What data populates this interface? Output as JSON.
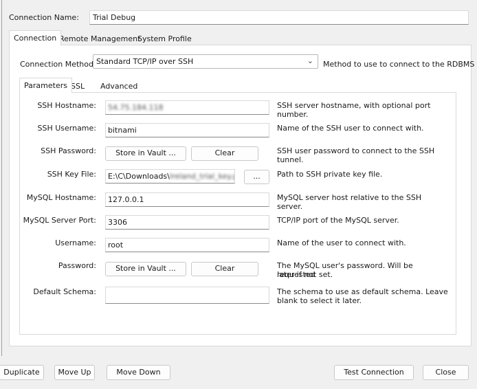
{
  "connection_name": {
    "label": "Connection Name:",
    "value": "Trial Debug"
  },
  "outer_tabs": [
    "Connection",
    "Remote Management",
    "System Profile"
  ],
  "connection_method": {
    "label": "Connection Method:",
    "value": "Standard TCP/IP over SSH",
    "description": "Method to use to connect to the RDBMS"
  },
  "inner_tabs": [
    "Parameters",
    "SSL",
    "Advanced"
  ],
  "params": {
    "ssh_hostname": {
      "label": "SSH Hostname:",
      "value": "54.75.184.118",
      "description": "SSH server hostname, with  optional port number."
    },
    "ssh_username": {
      "label": "SSH Username:",
      "value": "bitnami",
      "description": "Name of the SSH user to connect with."
    },
    "ssh_password": {
      "label": "SSH Password:",
      "store_label": "Store in Vault ...",
      "clear_label": "Clear",
      "description": "SSH user password to connect to the SSH tunnel."
    },
    "ssh_key_file": {
      "label": "SSH Key File:",
      "value_visible": "E:\\C\\Downloads\\",
      "value_blurred": "Ireland_trial_key.pem",
      "browse_label": "...",
      "description": "Path to SSH private key file."
    },
    "mysql_hostname": {
      "label": "MySQL Hostname:",
      "value": "127.0.0.1",
      "description": "MySQL server host relative to the SSH server."
    },
    "mysql_port": {
      "label": "MySQL Server Port:",
      "value": "3306",
      "description": "TCP/IP port of the MySQL server."
    },
    "username": {
      "label": "Username:",
      "value": "root",
      "description": "Name of the user to connect with."
    },
    "password": {
      "label": "Password:",
      "store_label": "Store in Vault ...",
      "clear_label": "Clear",
      "description_1": "The MySQL user's password. Will be requested",
      "description_2": "later if not set."
    },
    "default_schema": {
      "label": "Default Schema:",
      "value": "",
      "description_1": "The schema to use as default schema. Leave",
      "description_2": "blank to select it later."
    }
  },
  "footer": {
    "duplicate": "Duplicate",
    "move_up": "Move Up",
    "move_down": "Move Down",
    "test_connection": "Test Connection",
    "close": "Close"
  }
}
